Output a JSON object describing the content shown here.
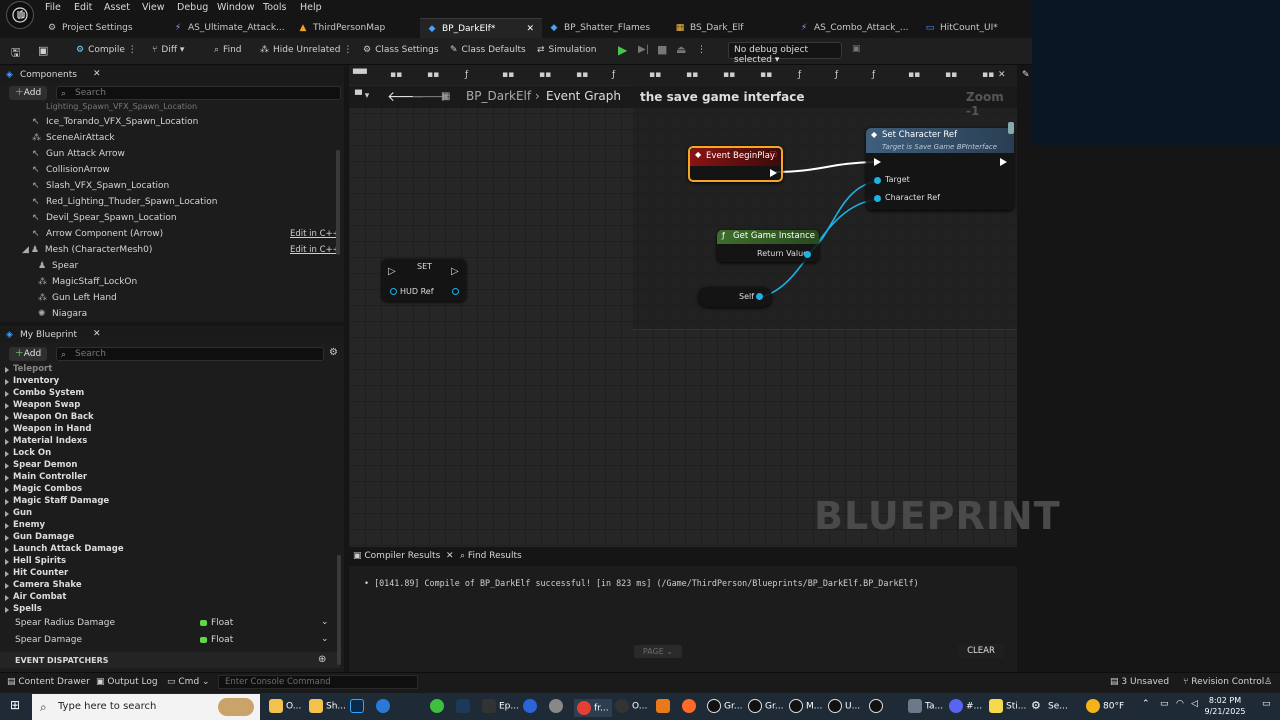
{
  "menu": [
    "File",
    "Edit",
    "Asset",
    "View",
    "Debug",
    "Window",
    "Tools",
    "Help"
  ],
  "tabs": [
    {
      "label": "Project Settings",
      "icon": "gear-icon",
      "active": false
    },
    {
      "label": "AS_Ultimate_Attack...",
      "icon": "anim-icon",
      "active": false
    },
    {
      "label": "ThirdPersonMap",
      "icon": "map-icon",
      "active": false
    },
    {
      "label": "BP_DarkElf*",
      "icon": "blueprint-icon",
      "active": true
    },
    {
      "label": "BP_Shatter_Flames",
      "icon": "blueprint-icon",
      "active": false
    },
    {
      "label": "BS_Dark_Elf",
      "icon": "blendspace-icon",
      "active": false
    },
    {
      "label": "AS_Combo_Attack_...",
      "icon": "anim-icon",
      "active": false
    },
    {
      "label": "HitCount_UI*",
      "icon": "widget-icon",
      "active": false
    }
  ],
  "toolbar": {
    "compile": "Compile",
    "diff": "Diff",
    "find": "Find",
    "hide_unrelated": "Hide Unrelated",
    "class_settings": "Class Settings",
    "class_defaults": "Class Defaults",
    "simulation": "Simulation",
    "debug_object": "No debug object selected"
  },
  "components": {
    "title": "Components",
    "add": "Add",
    "search_placeholder": "Search",
    "items": [
      {
        "label": "Ice_Torando_VFX_Spawn_Location",
        "icon": "arrow-icon"
      },
      {
        "label": "SceneAirAttack",
        "icon": "scene-icon"
      },
      {
        "label": "Gun Attack Arrow",
        "icon": "arrow-icon"
      },
      {
        "label": "CollisionArrow",
        "icon": "arrow-icon"
      },
      {
        "label": "Slash_VFX_Spawn_Location",
        "icon": "arrow-icon"
      },
      {
        "label": "Red_Lighting_Thuder_Spawn_Location",
        "icon": "arrow-icon"
      },
      {
        "label": "Devil_Spear_Spawn_Location",
        "icon": "arrow-icon"
      },
      {
        "label": "Arrow Component (Arrow)",
        "icon": "arrow-icon",
        "edit": "Edit in C++"
      },
      {
        "label": "Mesh (CharacterMesh0)",
        "icon": "mesh-icon",
        "edit": "Edit in C++"
      },
      {
        "label": "Spear",
        "icon": "mesh-icon"
      },
      {
        "label": "MagicStaff_LockOn",
        "icon": "scene-icon"
      },
      {
        "label": "Gun Left Hand",
        "icon": "scene-icon"
      },
      {
        "label": "Niagara",
        "icon": "niagara-icon"
      }
    ]
  },
  "my_blueprint": {
    "title": "My Blueprint",
    "add": "Add",
    "search_placeholder": "Search",
    "categories": [
      "Teleport",
      "Inventory",
      "Combo System",
      "Weapon Swap",
      "Weapon On Back",
      "Weapon in Hand",
      "Material Indexs",
      "Lock On",
      "Spear Demon",
      "Main Controller",
      "Magic Combos",
      "Magic Staff Damage",
      "Gun",
      "Enemy",
      "Gun Damage",
      "Launch Attack Damage",
      "Hell Spirits",
      "Hit Counter",
      "Camera Shake",
      "Air Combat",
      "Spells"
    ],
    "variables": [
      {
        "name": "Spear Radius Damage",
        "type": "Float"
      },
      {
        "name": "Spear Damage",
        "type": "Float"
      }
    ],
    "dispatchers": "EVENT DISPATCHERS"
  },
  "graph": {
    "breadcrumb_root": "BP_DarkElf",
    "breadcrumb_leaf": "Event Graph",
    "comment": "the save game interface",
    "zoom": "Zoom -1",
    "watermark": "BLUEPRINT",
    "nodes": {
      "event_begin_play": "Event BeginPlay",
      "set_character_ref": "Set Character Ref",
      "set_character_ref_sub": "Target is Save Game BPInterface",
      "target": "Target",
      "character_ref": "Character Ref",
      "get_game_instance": "Get Game Instance",
      "return_value": "Return Value",
      "self": "Self",
      "set": "SET",
      "hud_ref": "HUD Ref"
    }
  },
  "compiler": {
    "tab1": "Compiler Results",
    "tab2": "Find Results",
    "message": "[0141.89] Compile of BP_DarkElf successful! [in 823 ms] (/Game/ThirdPerson/Blueprints/BP_DarkElf.BP_DarkElf)",
    "page": "PAGE",
    "clear": "CLEAR"
  },
  "statusbar": {
    "content_drawer": "Content Drawer",
    "output_log": "Output Log",
    "cmd": "Cmd",
    "console_placeholder": "Enter Console Command",
    "unsaved": "3 Unsaved",
    "revision": "Revision Control"
  },
  "taskbar": {
    "search": "Type here to search",
    "items": [
      "O...",
      "Sh...",
      "Ep...",
      "fr...",
      "O...",
      "Gr...",
      "Gr...",
      "M...",
      "U...",
      "Ta...",
      "#...",
      "Sti...",
      "Se..."
    ],
    "weather": "80°F",
    "time": "8:02 PM",
    "date": "9/21/2025"
  },
  "colors": {
    "accent": "#f5a623",
    "pin": "#1bb3e6",
    "event": "#8a1414",
    "function": "#3e6e2b",
    "message": "#2f4c6b"
  }
}
